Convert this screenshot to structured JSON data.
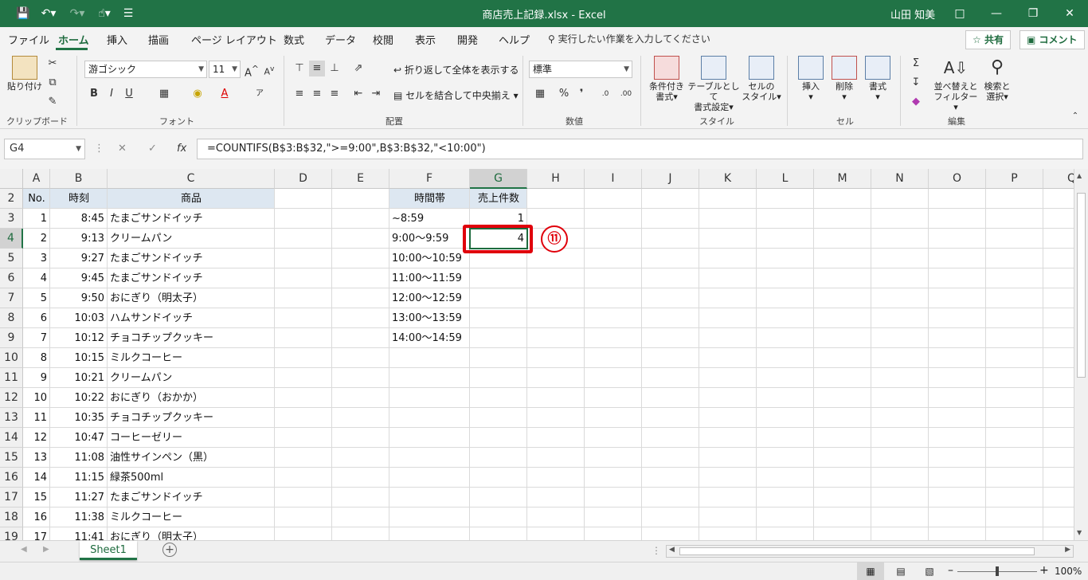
{
  "window": {
    "title": "商店売上記録.xlsx  -  Excel",
    "user": "山田 知美"
  },
  "ribbon_tabs": [
    "ファイル",
    "ホーム",
    "挿入",
    "描画",
    "ページ レイアウト",
    "数式",
    "データ",
    "校閲",
    "表示",
    "開発",
    "ヘルプ"
  ],
  "tell_me": "実行したい作業を入力してください",
  "share_label": "共有",
  "comment_label": "コメント",
  "ribbon": {
    "paste": "貼り付け",
    "clipboard": "クリップボード",
    "font_name": "游ゴシック",
    "font_size": "11",
    "font": "フォント",
    "wrap_text": "折り返して全体を表示する",
    "merge_center": "セルを結合して中央揃え",
    "alignment": "配置",
    "number_format": "標準",
    "number": "数値",
    "cond_format_1": "条件付き",
    "cond_format_2": "書式",
    "table_format_1": "テーブルとして",
    "table_format_2": "書式設定",
    "cell_style_1": "セルの",
    "cell_style_2": "スタイル",
    "styles": "スタイル",
    "insert": "挿入",
    "delete": "削除",
    "format": "書式",
    "cells": "セル",
    "sort_1": "並べ替えと",
    "sort_2": "フィルター",
    "find_1": "検索と",
    "find_2": "選択",
    "editing": "編集"
  },
  "namebox": "G4",
  "formula": "=COUNTIFS(B$3:B$32,\">=9:00\",B$3:B$32,\"<10:00\")",
  "columns": [
    "A",
    "B",
    "C",
    "D",
    "E",
    "F",
    "G",
    "H",
    "I",
    "J",
    "K",
    "L",
    "M",
    "N",
    "O",
    "P",
    "Q"
  ],
  "row_numbers": [
    "2",
    "3",
    "4",
    "5",
    "6",
    "7",
    "8",
    "9",
    "10",
    "11",
    "12",
    "13",
    "14",
    "15",
    "16",
    "17",
    "18",
    "19"
  ],
  "table_headers": {
    "no": "No.",
    "time": "時刻",
    "product": "商品"
  },
  "sales_rows": [
    {
      "no": "1",
      "time": "8:45",
      "product": "たまごサンドイッチ"
    },
    {
      "no": "2",
      "time": "9:13",
      "product": "クリームパン"
    },
    {
      "no": "3",
      "time": "9:27",
      "product": "たまごサンドイッチ"
    },
    {
      "no": "4",
      "time": "9:45",
      "product": "たまごサンドイッチ"
    },
    {
      "no": "5",
      "time": "9:50",
      "product": "おにぎり（明太子）"
    },
    {
      "no": "6",
      "time": "10:03",
      "product": "ハムサンドイッチ"
    },
    {
      "no": "7",
      "time": "10:12",
      "product": "チョコチップクッキー"
    },
    {
      "no": "8",
      "time": "10:15",
      "product": "ミルクコーヒー"
    },
    {
      "no": "9",
      "time": "10:21",
      "product": "クリームパン"
    },
    {
      "no": "10",
      "time": "10:22",
      "product": "おにぎり（おかか）"
    },
    {
      "no": "11",
      "time": "10:35",
      "product": "チョコチップクッキー"
    },
    {
      "no": "12",
      "time": "10:47",
      "product": "コーヒーゼリー"
    },
    {
      "no": "13",
      "time": "11:08",
      "product": "油性サインペン（黒）"
    },
    {
      "no": "14",
      "time": "11:15",
      "product": "緑茶500ml"
    },
    {
      "no": "15",
      "time": "11:27",
      "product": "たまごサンドイッチ"
    },
    {
      "no": "16",
      "time": "11:38",
      "product": "ミルクコーヒー"
    },
    {
      "no": "17",
      "time": "11:41",
      "product": "おにぎり（明太子）"
    }
  ],
  "summary_headers": {
    "slot": "時間帯",
    "count": "売上件数"
  },
  "summary_rows": [
    {
      "slot": "~8:59",
      "count": "1"
    },
    {
      "slot": "9:00～9:59",
      "count": "4"
    },
    {
      "slot": "10:00～10:59",
      "count": ""
    },
    {
      "slot": "11:00～11:59",
      "count": ""
    },
    {
      "slot": "12:00～12:59",
      "count": ""
    },
    {
      "slot": "13:00～13:59",
      "count": ""
    },
    {
      "slot": "14:00～14:59",
      "count": ""
    }
  ],
  "step_badge": "⑪",
  "sheet_tab": "Sheet1",
  "zoom": "100%",
  "colors": {
    "excel_green": "#217346",
    "highlight_red": "#e0000b",
    "header_fill": "#dde7f1"
  }
}
